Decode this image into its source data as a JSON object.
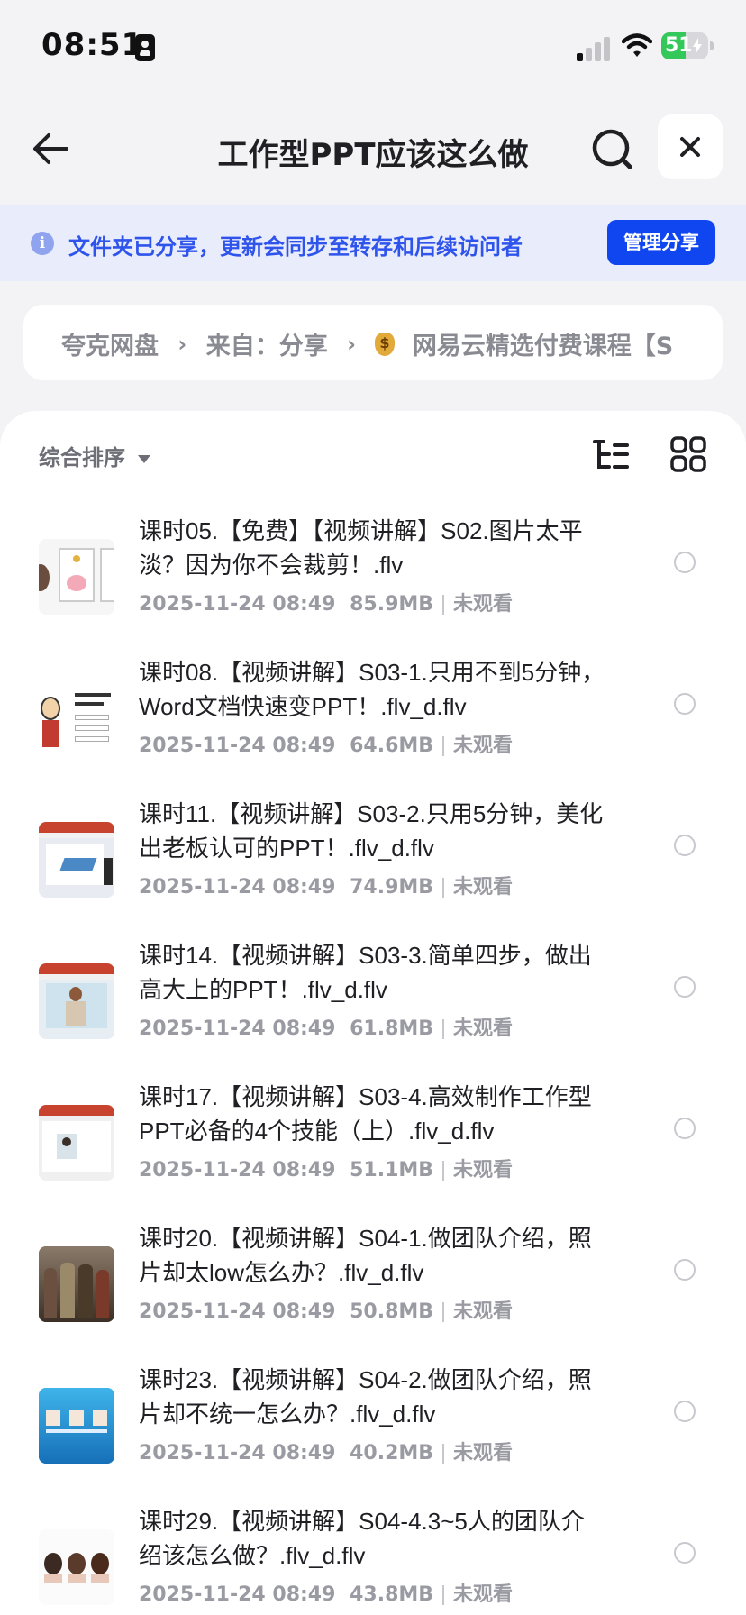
{
  "status_bar": {
    "time": "08:51",
    "battery": "51",
    "battery_level": 0.51
  },
  "nav": {
    "title": "工作型PPT应该这么做"
  },
  "share_banner": {
    "text": "文件夹已分享，更新会同步至转存和后续访问者",
    "button_label": "管理分享"
  },
  "breadcrumb": {
    "items": [
      "夸克网盘",
      "来自：分享",
      "网易云精选付费课程【S"
    ]
  },
  "toolbar": {
    "sort_label": "综合排序"
  },
  "files": [
    {
      "name": "课时05.【免费】【视频讲解】S02.图片太平淡？因为你不会裁剪！.flv",
      "date": "2025-11-24 08:49",
      "size": "85.9MB",
      "status": "未观看",
      "thumb_icon": "piggy-bank-slide-thumbnail"
    },
    {
      "name": "课时08.【视频讲解】S03-1.只用不到5分钟，Word文档快速变PPT！.flv_d.flv",
      "date": "2025-11-24 08:49",
      "size": "64.6MB",
      "status": "未观看",
      "thumb_icon": "word-to-ppt-slide-thumbnail"
    },
    {
      "name": "课时11.【视频讲解】S03-2.只用5分钟，美化出老板认可的PPT！.flv_d.flv",
      "date": "2025-11-24 08:49",
      "size": "74.9MB",
      "status": "未观看",
      "thumb_icon": "ppt-editor-slide-thumbnail"
    },
    {
      "name": "课时14.【视频讲解】S03-3.简单四步，做出高大上的PPT！.flv_d.flv",
      "date": "2025-11-24 08:49",
      "size": "61.8MB",
      "status": "未观看",
      "thumb_icon": "ppt-editor-person-thumbnail"
    },
    {
      "name": "课时17.【视频讲解】S03-4.高效制作工作型PPT必备的4个技能（上）.flv_d.flv",
      "date": "2025-11-24 08:49",
      "size": "51.1MB",
      "status": "未观看",
      "thumb_icon": "ppt-editor-portrait-thumbnail"
    },
    {
      "name": "课时20.【视频讲解】S04-1.做团队介绍，照片却太low怎么办？.flv_d.flv",
      "date": "2025-11-24 08:49",
      "size": "50.8MB",
      "status": "未观看",
      "thumb_icon": "group-photo-thumbnail"
    },
    {
      "name": "课时23.【视频讲解】S04-2.做团队介绍，照片却不统一怎么办？.flv_d.flv",
      "date": "2025-11-24 08:49",
      "size": "40.2MB",
      "status": "未观看",
      "thumb_icon": "team-slide-blue-thumbnail"
    },
    {
      "name": "课时29.【视频讲解】S04-4.3~5人的团队介绍该怎么做？.flv_d.flv",
      "date": "2025-11-24 08:49",
      "size": "43.8MB",
      "status": "未观看",
      "thumb_icon": "team-portraits-thumbnail"
    }
  ]
}
